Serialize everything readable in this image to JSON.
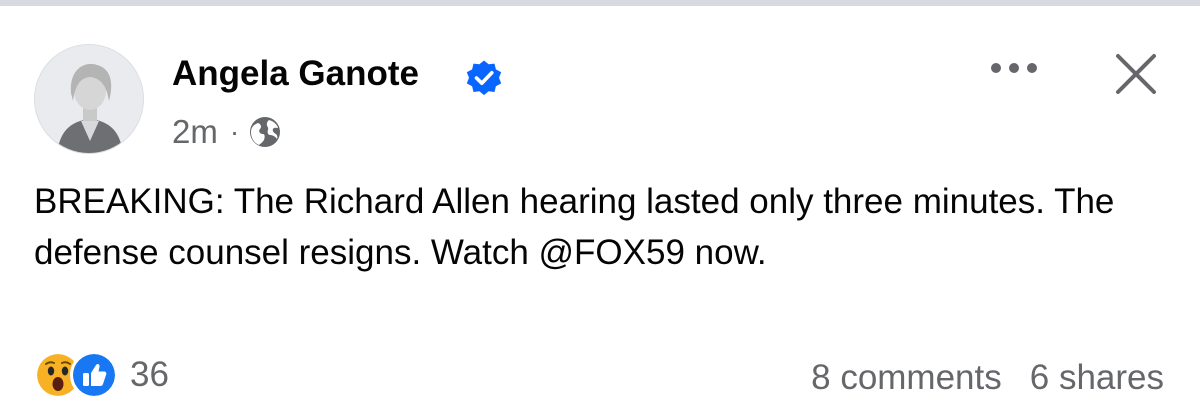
{
  "post": {
    "author": "Angela Ganote",
    "time": "2m",
    "separator": "·",
    "privacy_icon": "globe-icon",
    "text": "BREAKING: The Richard Allen hearing lasted only three minutes. The defense counsel resigns. Watch @FOX59 now.",
    "reactions": {
      "icons": [
        "wow-icon",
        "like-icon"
      ],
      "count": "36"
    },
    "comments": "8 comments",
    "shares": "6 shares"
  },
  "colors": {
    "verified_blue": "#0866ff",
    "like_blue": "#1877f2",
    "wow_yellow": "#f7b125",
    "secondary_text": "#65676b"
  }
}
